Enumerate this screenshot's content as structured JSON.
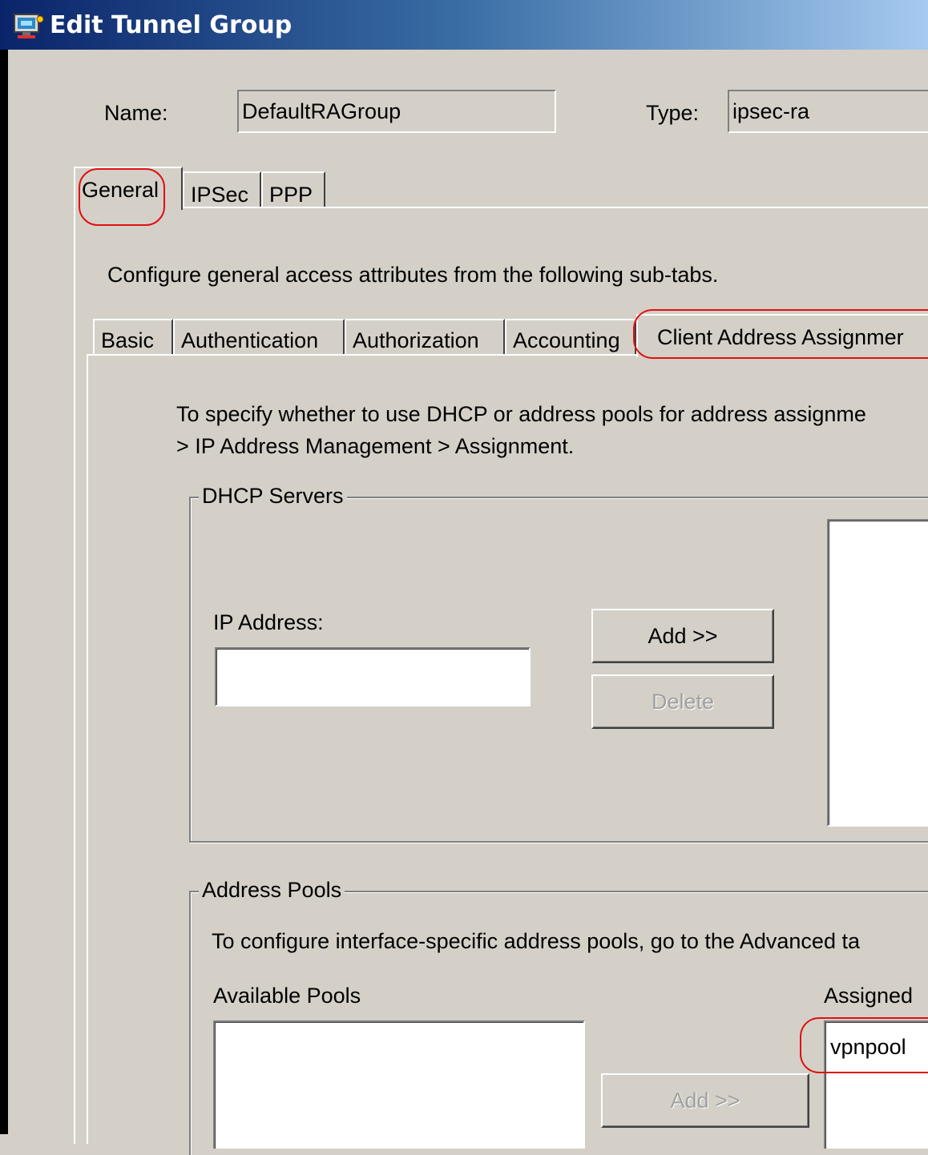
{
  "window": {
    "title": "Edit Tunnel Group",
    "icon": "network-app-icon"
  },
  "header": {
    "name_label": "Name:",
    "name_value": "DefaultRAGroup",
    "type_label": "Type:",
    "type_value": "ipsec-ra"
  },
  "main_tabs": [
    {
      "label": "General",
      "selected": true
    },
    {
      "label": "IPSec",
      "selected": false
    },
    {
      "label": "PPP",
      "selected": false
    }
  ],
  "general": {
    "description": "Configure general access attributes from the following sub-tabs."
  },
  "sub_tabs": [
    {
      "label": "Basic",
      "selected": false
    },
    {
      "label": "Authentication",
      "selected": false
    },
    {
      "label": "Authorization",
      "selected": false
    },
    {
      "label": "Accounting",
      "selected": false
    },
    {
      "label": "Client Address Assignmer",
      "selected": true
    }
  ],
  "client_address": {
    "instructions_line1": "To specify whether to use DHCP or address pools for address assignme",
    "instructions_line2": "> IP Address Management > Assignment."
  },
  "dhcp_servers": {
    "legend": "DHCP Servers",
    "ip_label": "IP Address:",
    "ip_value": "",
    "add_button": "Add >>",
    "delete_button": "Delete",
    "servers": []
  },
  "address_pools": {
    "legend": "Address Pools",
    "instructions": "To configure interface-specific address pools, go to the Advanced ta",
    "available_label": "Available Pools",
    "available": [],
    "add_button": "Add >>",
    "assigned_label": "Assigned",
    "assigned": [
      "vpnpool"
    ]
  },
  "colors": {
    "title_bar_start": "#0a246a",
    "title_bar_end": "#a6caf0",
    "window_bg": "#d4d0c8",
    "annotation": "#e01010"
  }
}
